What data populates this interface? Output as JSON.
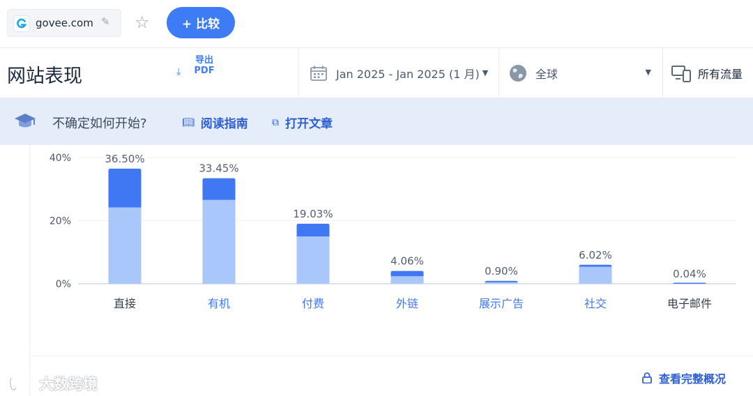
{
  "topbar": {
    "site": "govee.com",
    "compare_label": "+ 比较"
  },
  "header": {
    "title": "网站表现",
    "export_label": "导出PDF",
    "date_range": "Jan 2025 - Jan 2025 (1 月)",
    "geo": "全球",
    "traffic": "所有流量"
  },
  "banner": {
    "question": "不确定如何开始?",
    "guide_link": "阅读指南",
    "article_link": "打开文章"
  },
  "chart_data": {
    "type": "bar",
    "categories": [
      "直接",
      "有机",
      "付费",
      "外链",
      "展示广告",
      "社交",
      "电子邮件"
    ],
    "values": [
      36.5,
      33.45,
      19.03,
      4.06,
      0.9,
      6.02,
      0.04
    ],
    "value_labels": [
      "36.50%",
      "33.45%",
      "19.03%",
      "4.06%",
      "0.90%",
      "6.02%",
      "0.04%"
    ],
    "series": [
      {
        "values": [
          24.2,
          26.6,
          15.0,
          2.4,
          0.5,
          5.4,
          0.04
        ],
        "color": "#a9c7fb"
      },
      {
        "values": [
          12.3,
          6.85,
          4.03,
          1.66,
          0.4,
          0.62,
          0.0
        ],
        "color": "#3f78f2"
      }
    ],
    "yticks": [
      "0%",
      "20%",
      "40%"
    ],
    "ylim": [
      0,
      40
    ],
    "grid": true,
    "label_colors": [
      "#333f4d",
      "#3f78f2",
      "#3f78f2",
      "#3f78f2",
      "#3f78f2",
      "#3f78f2",
      "#333f4d"
    ]
  },
  "footer": {
    "full_overview": "查看完整概况",
    "watermark": "大数跨境"
  },
  "colors": {
    "accent": "#3e7cf5",
    "link": "#2e5fd1",
    "banner_bg": "#e5edfb"
  }
}
